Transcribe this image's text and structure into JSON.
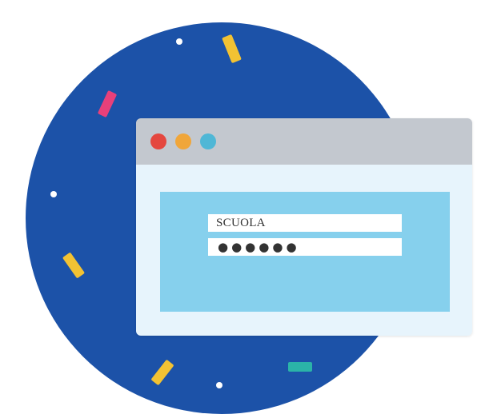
{
  "illustration": {
    "circle_color": "#1c52a8",
    "confetti": [
      {
        "name": "confetti-yellow-top",
        "color": "#f2c233",
        "rotate": -22
      },
      {
        "name": "confetti-pink-top",
        "color": "#e8407a",
        "rotate": 25
      },
      {
        "name": "confetti-yellow-left",
        "color": "#f2c233",
        "rotate": -35
      },
      {
        "name": "confetti-yellow-bottom",
        "color": "#f2c233",
        "rotate": 38
      },
      {
        "name": "confetti-teal-bottom",
        "color": "#2bb4a8",
        "rotate": 0
      }
    ],
    "dot_color": "#ffffff"
  },
  "browser": {
    "titlebar_color": "#c3c8cf",
    "body_color": "#e7f4fc",
    "panel_color": "#86d0ed",
    "traffic_dots": [
      {
        "name": "close-dot",
        "color": "#e4473f"
      },
      {
        "name": "minimize-dot",
        "color": "#f0a63a"
      },
      {
        "name": "zoom-dot",
        "color": "#4fb7d6"
      }
    ]
  },
  "login": {
    "username_value": "SCUOLA",
    "password_value": "●●●●●●"
  }
}
